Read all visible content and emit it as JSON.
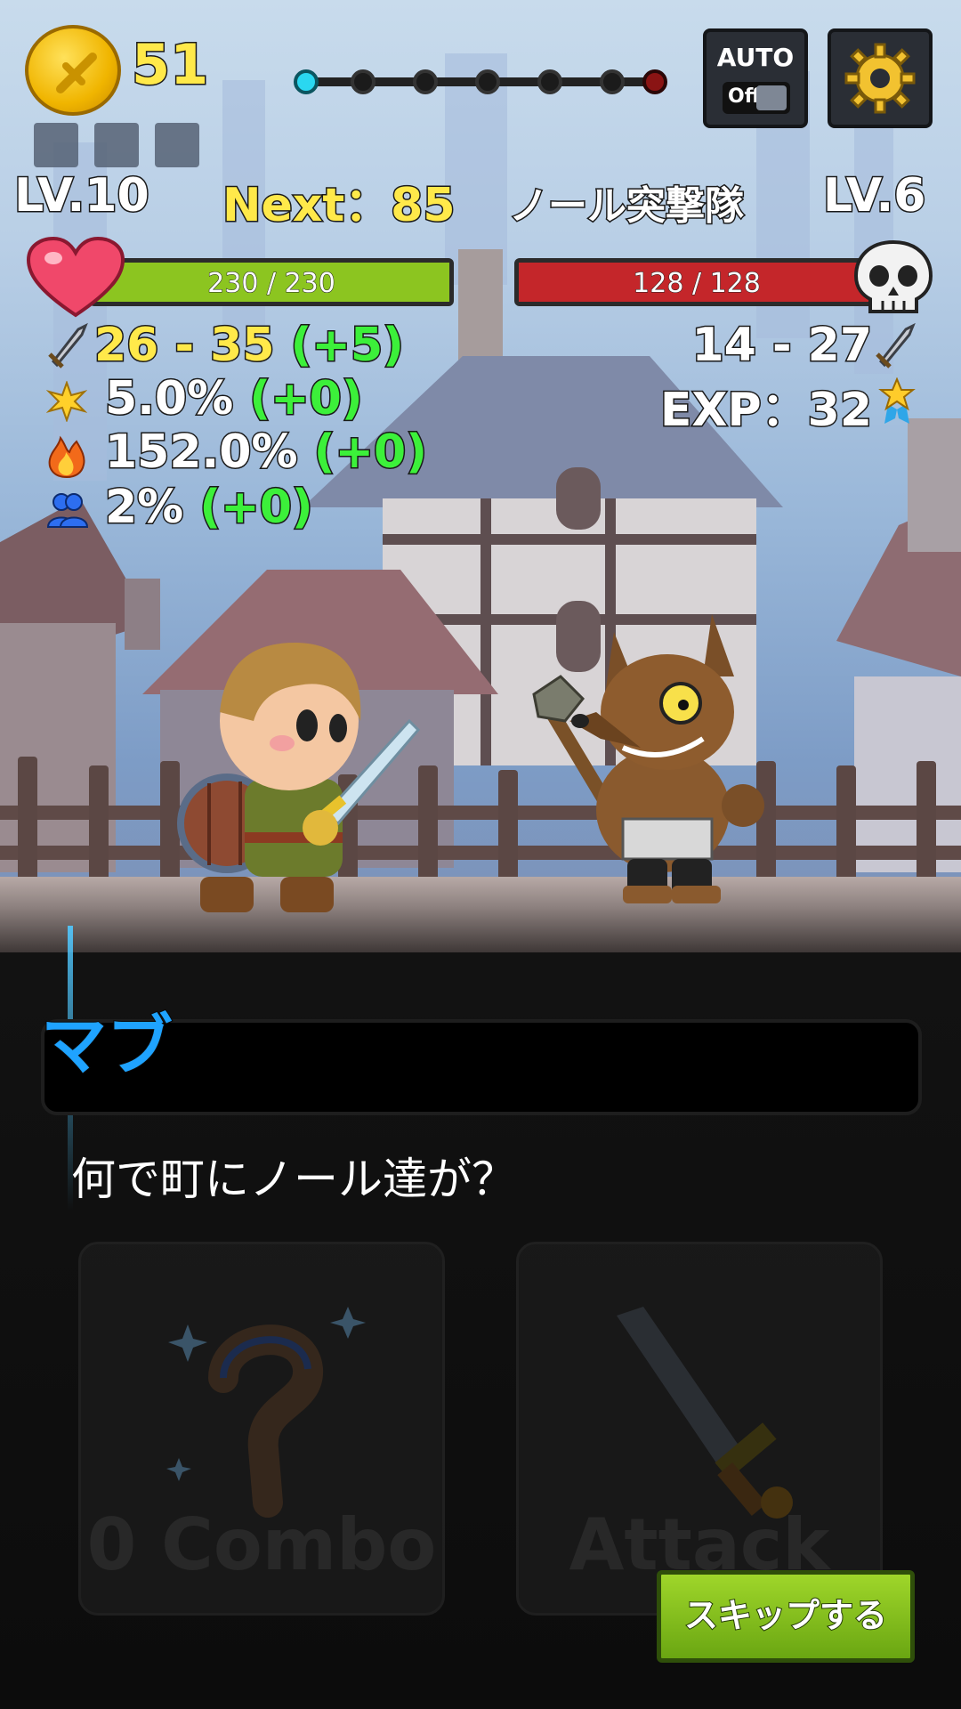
{
  "hud": {
    "gold": "51",
    "auto_label": "AUTO",
    "auto_state": "Off",
    "stage_nodes": 7,
    "stage_current_index": 0
  },
  "player": {
    "level": "LV.10",
    "next": "Next：85",
    "hp": "230 / 230",
    "hp_fraction": 1.0,
    "attack": "26 - 35",
    "attack_bonus": "(+5)",
    "crit_rate": "5.0%",
    "crit_rate_bonus": "(+0)",
    "crit_damage": "152.0%",
    "crit_damage_bonus": "(+0)",
    "extra": "2%",
    "extra_bonus": "(+0)"
  },
  "enemy": {
    "name": "ノール突撃隊",
    "level": "LV.6",
    "hp": "128 / 128",
    "hp_fraction": 1.0,
    "attack": "14 - 27",
    "exp": "EXP：32"
  },
  "dialog": {
    "speaker": "マブ",
    "text": "何で町にノール達が？"
  },
  "cards": {
    "combo_label": "0 Combo",
    "attack_label": "Attack"
  },
  "skip_label": "スキップする",
  "colors": {
    "player_hp": "#8cc520",
    "enemy_hp": "#c4262a",
    "speaker": "#1fa3ff",
    "bonus": "#3cf03a",
    "gold": "#ffe94a"
  }
}
